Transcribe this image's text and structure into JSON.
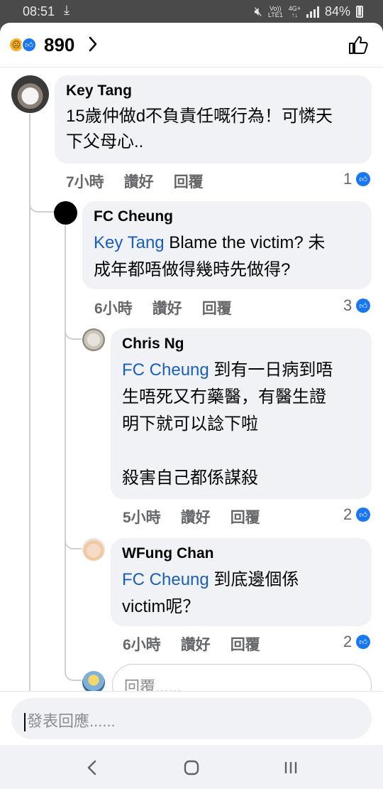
{
  "status_bar": {
    "time": "08:51",
    "network_top": "Vo))",
    "network_bottom": "LTE1",
    "net_type_top": "4G+",
    "net_type_bottom": "↑↓",
    "battery": "84%"
  },
  "header": {
    "reaction_count": "890",
    "reactions": [
      "sad",
      "like"
    ]
  },
  "comments": [
    {
      "name": "Key Tang",
      "mention": "",
      "text": "15歲仲做d不負責任嘅行為！可憐天\n下父母心..",
      "time": "7小時",
      "like_label": "讚好",
      "reply_label": "回覆",
      "like_count": "1"
    },
    {
      "name": "FC Cheung",
      "mention": "Key Tang",
      "text": " Blame the victim? 未\n成年都唔做得幾時先做得?",
      "time": "6小時",
      "like_label": "讚好",
      "reply_label": "回覆",
      "like_count": "3"
    },
    {
      "name": "Chris Ng",
      "mention": "FC Cheung",
      "text": " 到有一日病到唔\n生唔死又冇藥醫，有醫生證\n明下就可以諗下啦\n\n殺害自己都係謀殺",
      "time": "5小時",
      "like_label": "讚好",
      "reply_label": "回覆",
      "like_count": "2"
    },
    {
      "name": "WFung Chan",
      "mention": "FC Cheung",
      "text": " 到底邊個係\nvictim呢？",
      "time": "6小時",
      "like_label": "讚好",
      "reply_label": "回覆",
      "like_count": "2"
    }
  ],
  "reply_placeholder": "回覆......",
  "composer_placeholder": "發表回應......",
  "colors": {
    "accent": "#1877f2",
    "mention": "#1b5fb6",
    "bubble": "#f0f2f5"
  }
}
